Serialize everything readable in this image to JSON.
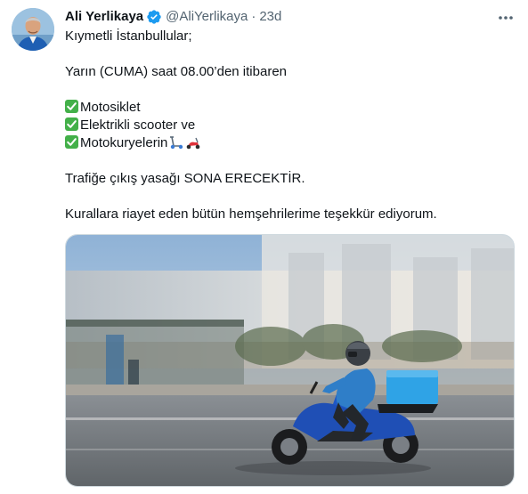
{
  "tweet": {
    "author_name": "Ali Yerlikaya",
    "handle": "@AliYerlikaya",
    "separator": "·",
    "time": "23d",
    "verified": true,
    "icons": {
      "avatar": "avatar-photo",
      "verified": "verified-badge-icon",
      "more": "more-options-icon",
      "check": "check-mark-emoji",
      "scooter": "kick-scooter-emoji",
      "motor_scooter": "motor-scooter-emoji"
    },
    "lines": {
      "greeting": "Kıymetli İstanbullular;",
      "announcement": "Yarın (CUMA) saat 08.00’den itibaren",
      "item1": "Motosiklet",
      "item2": "Elektrikli scooter ve",
      "item3": "Motokuryelerin",
      "statement": "Trafiğe çıkış yasağı SONA ERECEKTİR.",
      "thanks": "Kurallara riayet eden bütün hemşehrilerime teşekkür ediyorum."
    },
    "media": {
      "description_icon": "courier-on-scooter-photo"
    },
    "colors": {
      "verified_blue": "#1d9bf0",
      "check_green": "#43b049",
      "secondary_text": "#536471"
    }
  }
}
